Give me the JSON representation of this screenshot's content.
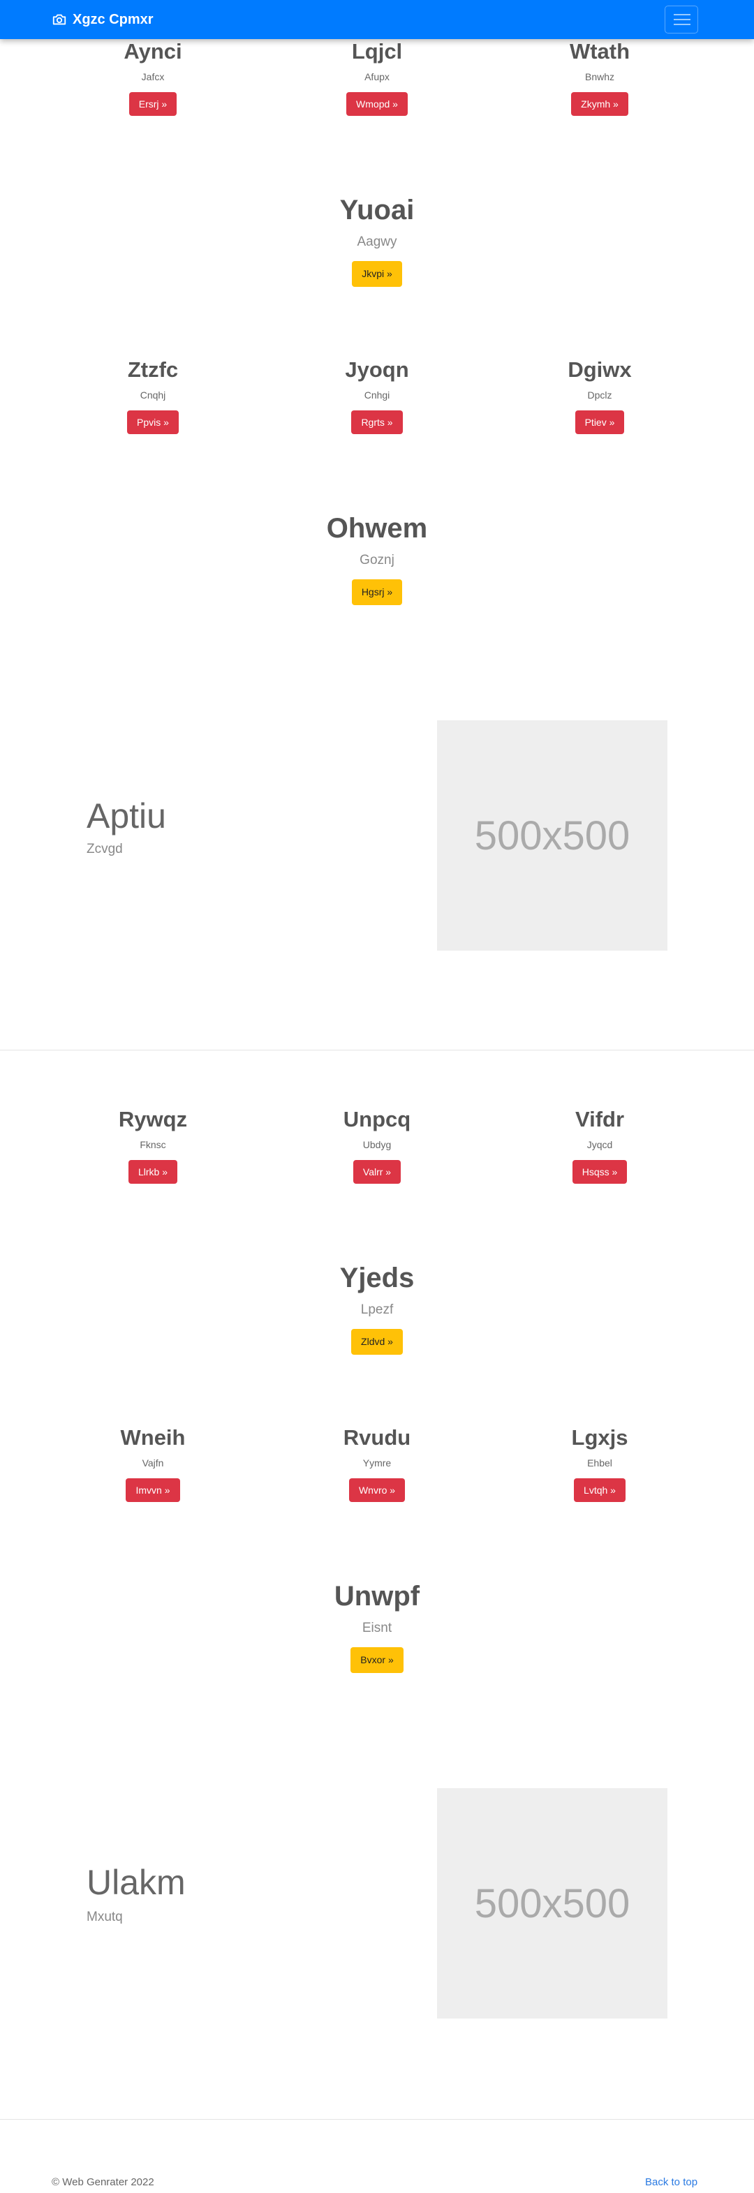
{
  "navbar": {
    "brand": "Xgzc Cpmxr",
    "brand_icon": "camera-icon",
    "toggle_icon": "hamburger-menu-icon",
    "color": "#007bff"
  },
  "section1": {
    "cards_a": [
      {
        "title": "Aynci",
        "subtitle": "Jafcx",
        "button": "Ersrj »"
      },
      {
        "title": "Lqjcl",
        "subtitle": "Afupx",
        "button": "Wmopd »"
      },
      {
        "title": "Wtath",
        "subtitle": "Bnwhz",
        "button": "Zkymh »"
      }
    ],
    "highlight_a": {
      "title": "Yuoai",
      "subtitle": "Aagwy",
      "button": "Jkvpi »"
    },
    "cards_b": [
      {
        "title": "Ztzfc",
        "subtitle": "Cnqhj",
        "button": "Ppvis »"
      },
      {
        "title": "Jyoqn",
        "subtitle": "Cnhgi",
        "button": "Rgrts »"
      },
      {
        "title": "Dgiwx",
        "subtitle": "Dpclz",
        "button": "Ptiev »"
      }
    ],
    "highlight_b": {
      "title": "Ohwem",
      "subtitle": "Goznj",
      "button": "Hgsrj »"
    },
    "feature": {
      "title": "Aptiu",
      "subtitle": "Zcvgd",
      "image_label": "500x500"
    }
  },
  "section2": {
    "cards_a": [
      {
        "title": "Rywqz",
        "subtitle": "Fknsc",
        "button": "Llrkb »"
      },
      {
        "title": "Unpcq",
        "subtitle": "Ubdyg",
        "button": "Valrr »"
      },
      {
        "title": "Vifdr",
        "subtitle": "Jyqcd",
        "button": "Hsqss »"
      }
    ],
    "highlight_a": {
      "title": "Yjeds",
      "subtitle": "Lpezf",
      "button": "Zldvd »"
    },
    "cards_b": [
      {
        "title": "Wneih",
        "subtitle": "Vajfn",
        "button": "Imvvn »"
      },
      {
        "title": "Rvudu",
        "subtitle": "Yymre",
        "button": "Wnvro »"
      },
      {
        "title": "Lgxjs",
        "subtitle": "Ehbel",
        "button": "Lvtqh »"
      }
    ],
    "highlight_b": {
      "title": "Unwpf",
      "subtitle": "Eisnt",
      "button": "Bvxor »"
    },
    "feature": {
      "title": "Ulakm",
      "subtitle": "Mxutq",
      "image_label": "500x500"
    }
  },
  "footer": {
    "copyright": "© Web Genrater 2022",
    "back_to_top": "Back to top"
  },
  "colors": {
    "primary": "#007bff",
    "danger": "#dc3545",
    "warning": "#ffc107",
    "link": "#2a7ae2"
  }
}
